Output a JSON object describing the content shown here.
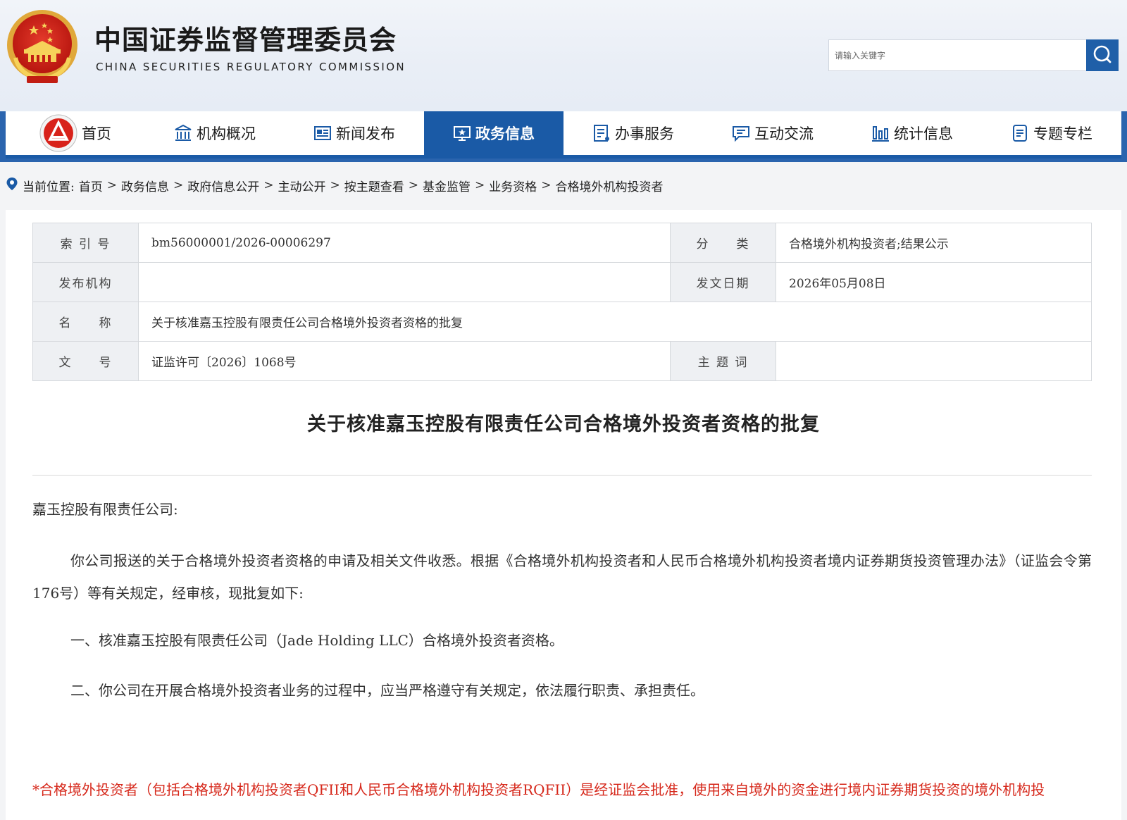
{
  "header": {
    "title": "中国证券监督管理委员会",
    "subtitle": "CHINA SECURITIES REGULATORY COMMISSION",
    "search_placeholder": "请输入关键字"
  },
  "nav": {
    "items": [
      {
        "label": "首页",
        "icon": "csrc-badge-icon"
      },
      {
        "label": "机构概况",
        "icon": "institution-icon"
      },
      {
        "label": "新闻发布",
        "icon": "news-icon"
      },
      {
        "label": "政务信息",
        "icon": "government-info-icon",
        "active": true
      },
      {
        "label": "办事服务",
        "icon": "service-icon"
      },
      {
        "label": "互动交流",
        "icon": "chat-icon"
      },
      {
        "label": "统计信息",
        "icon": "bar-chart-icon"
      },
      {
        "label": "专题专栏",
        "icon": "document-icon"
      }
    ],
    "accent": "#1a5aa6"
  },
  "breadcrumb": {
    "prefix": "当前位置:",
    "items": [
      "首页",
      "政务信息",
      "政府信息公开",
      "主动公开",
      "按主题查看",
      "基金监管",
      "业务资格",
      "合格境外机构投资者"
    ],
    "separator": ">"
  },
  "meta": {
    "index_label": "索 引 号",
    "index_value": "bm56000001/2026-00006297",
    "category_label": "分　　类",
    "category_value": "合格境外机构投资者;结果公示",
    "issuer_label": "发布机构",
    "issuer_value": "",
    "date_label": "发文日期",
    "date_value": "2026年05月08日",
    "name_label": "名　　称",
    "name_value": "关于核准嘉玉控股有限责任公司合格境外投资者资格的批复",
    "docno_label": "文　　号",
    "docno_value": "证监许可〔2026〕1068号",
    "keyword_label": "主 题 词",
    "keyword_value": ""
  },
  "document": {
    "title": "关于核准嘉玉控股有限责任公司合格境外投资者资格的批复",
    "salutation": "嘉玉控股有限责任公司:",
    "body": "你公司报送的关于合格境外投资者资格的申请及相关文件收悉。根据《合格境外机构投资者和人民币合格境外机构投资者境内证券期货投资管理办法》（证监会令第176号）等有关规定，经审核，现批复如下:",
    "item1": "一、核准嘉玉控股有限责任公司（Jade Holding LLC）合格境外投资者资格。",
    "item2": "二、你公司在开展合格境外投资者业务的过程中，应当严格遵守有关规定，依法履行职责、承担责任。",
    "footnote": "*合格境外投资者（包括合格境外机构投资者QFII和人民币合格境外机构投资者RQFII）是经证监会批准，使用来自境外的资金进行境内证券期货投资的境外机构投",
    "footnote_color": "#d6281b"
  }
}
